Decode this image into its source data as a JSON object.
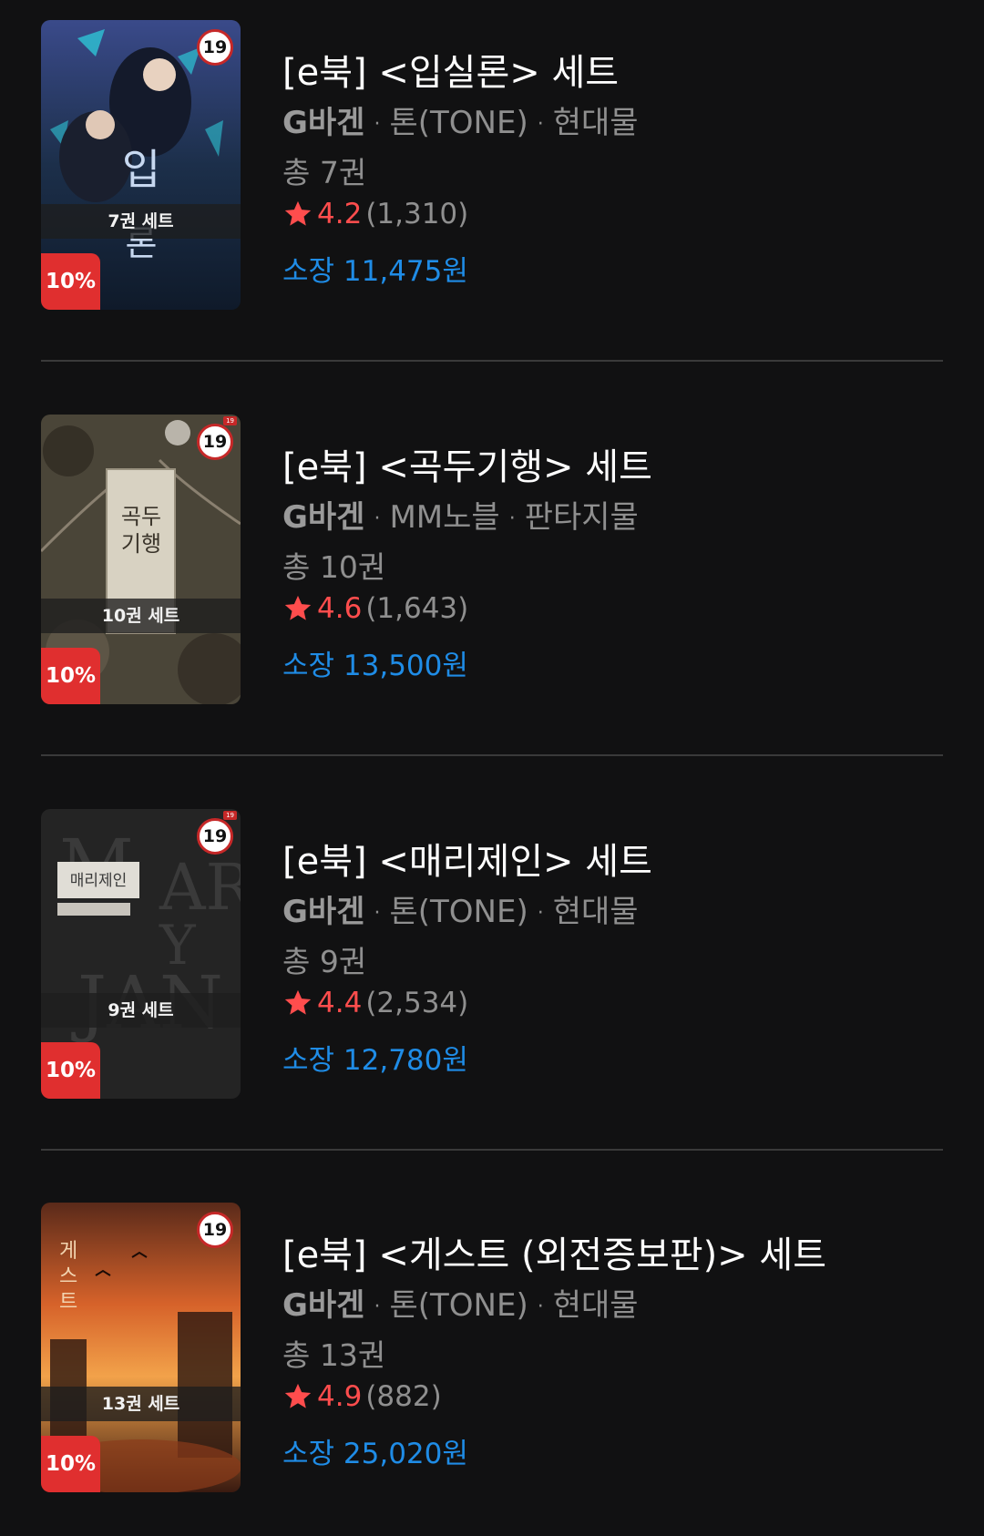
{
  "items": [
    {
      "title": "[e북] <입실론> 세트",
      "author": "G바겐",
      "publisher": "톤(TONE)",
      "genre": "현대물",
      "count": "총 7권",
      "score": "4.2",
      "reviews": "(1,310)",
      "price": "소장 11,475원",
      "set_label": "7권 세트",
      "discount": "10%",
      "age": "19"
    },
    {
      "title": "[e북] <곡두기행> 세트",
      "author": "G바겐",
      "publisher": "MM노블",
      "genre": "판타지물",
      "count": "총 10권",
      "score": "4.6",
      "reviews": "(1,643)",
      "price": "소장 13,500원",
      "set_label": "10권 세트",
      "discount": "10%",
      "age": "19"
    },
    {
      "title": "[e북] <매리제인> 세트",
      "author": "G바겐",
      "publisher": "톤(TONE)",
      "genre": "현대물",
      "count": "총 9권",
      "score": "4.4",
      "reviews": "(2,534)",
      "price": "소장 12,780원",
      "set_label": "9권 세트",
      "discount": "10%",
      "age": "19"
    },
    {
      "title": "[e북] <게스트 (외전증보판)> 세트",
      "author": "G바겐",
      "publisher": "톤(TONE)",
      "genre": "현대물",
      "count": "총 13권",
      "score": "4.9",
      "reviews": "(882)",
      "price": "소장 25,020원",
      "set_label": "13권 세트",
      "discount": "10%",
      "age": "19"
    }
  ],
  "colors": {
    "background": "#111112",
    "rating": "#ff4d4d",
    "price": "#1f8ce6",
    "discount_badge": "#e02f2f"
  },
  "icons": {
    "rating": "star-icon"
  }
}
